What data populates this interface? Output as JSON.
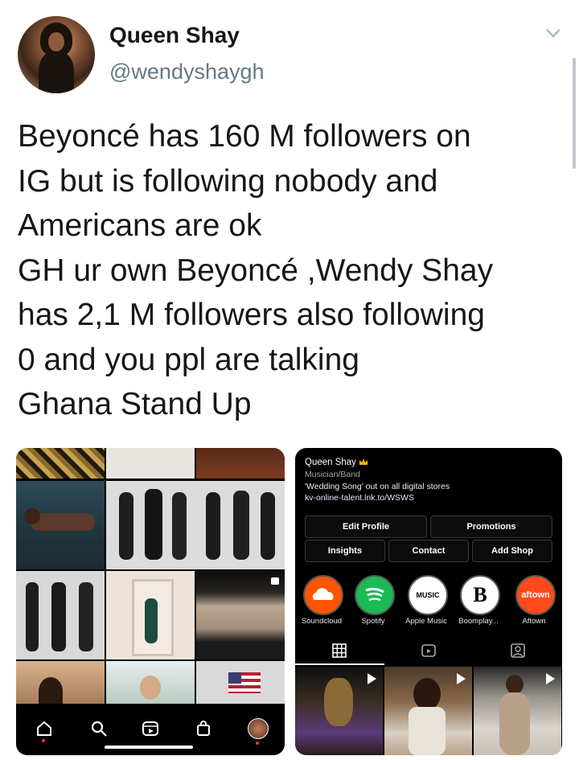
{
  "tweet": {
    "display_name": "Queen Shay",
    "handle": "@wendyshaygh",
    "lines": [
      "Beyoncé has 160 M followers on",
      "IG but is following nobody and",
      "Americans are ok",
      "GH ur own Beyoncé ,Wendy Shay",
      "has 2,1 M followers also following",
      "0 and you ppl are talking",
      "Ghana Stand Up"
    ]
  },
  "profile": {
    "name": "Queen Shay",
    "category": "Musician/Band",
    "bio": "'Wedding Song' out on all digital stores",
    "link": "kv-online-talent.lnk.to/WSWS",
    "buttons": [
      "Edit Profile",
      "Promotions",
      "Insights",
      "Contact",
      "Add Shop"
    ],
    "highlights": [
      {
        "label": "Soundcloud",
        "icon": "soundcloud-icon",
        "color": "#ff5500"
      },
      {
        "label": "Spotify",
        "icon": "spotify-icon",
        "color": "#1db954"
      },
      {
        "label": "Apple Music",
        "icon": "apple-music-icon",
        "color": "#ffffff",
        "badge": "MUSIC"
      },
      {
        "label": "Boomplay...",
        "icon": "boomplay-icon",
        "color": "#ffffff",
        "badge": "B"
      },
      {
        "label": "Aftown",
        "icon": "aftown-icon",
        "color": "#ff4a1c",
        "badge": "aftown"
      }
    ]
  },
  "colors": {
    "text": "#14171a",
    "muted": "#657786",
    "ig_bg": "#000000"
  }
}
